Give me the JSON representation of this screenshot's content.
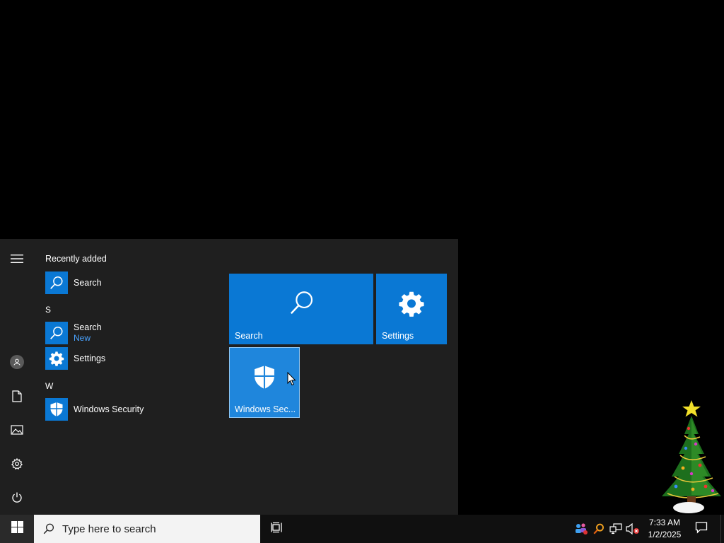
{
  "start_menu": {
    "recently_added_title": "Recently added",
    "recent_items": [
      {
        "label": "Search",
        "icon": "search-icon"
      }
    ],
    "groups": [
      {
        "letter": "S",
        "items": [
          {
            "label": "Search",
            "sublabel": "New",
            "icon": "search-icon"
          },
          {
            "label": "Settings",
            "icon": "gear-icon"
          }
        ]
      },
      {
        "letter": "W",
        "items": [
          {
            "label": "Windows Security",
            "icon": "shield-icon"
          }
        ]
      }
    ],
    "tiles": [
      {
        "label": "Search",
        "icon": "search-icon"
      },
      {
        "label": "Settings",
        "icon": "gear-icon"
      },
      {
        "label": "Windows Sec...",
        "icon": "shield-icon"
      }
    ],
    "rail": [
      "hamburger-menu-icon",
      "user-avatar-icon",
      "documents-icon",
      "pictures-icon",
      "settings-icon",
      "power-icon"
    ]
  },
  "taskbar": {
    "search_placeholder": "Type here to search",
    "tray_icons": [
      "people-icon",
      "search-tool-icon",
      "network-icon",
      "volume-muted-icon"
    ],
    "clock": {
      "time": "7:33 AM",
      "date": "1/2/2025"
    }
  },
  "colors": {
    "accent": "#0a78d4",
    "menu_bg": "#1f1f1f",
    "taskbar_bg": "#101010",
    "sublabel": "#4aa3ff"
  }
}
